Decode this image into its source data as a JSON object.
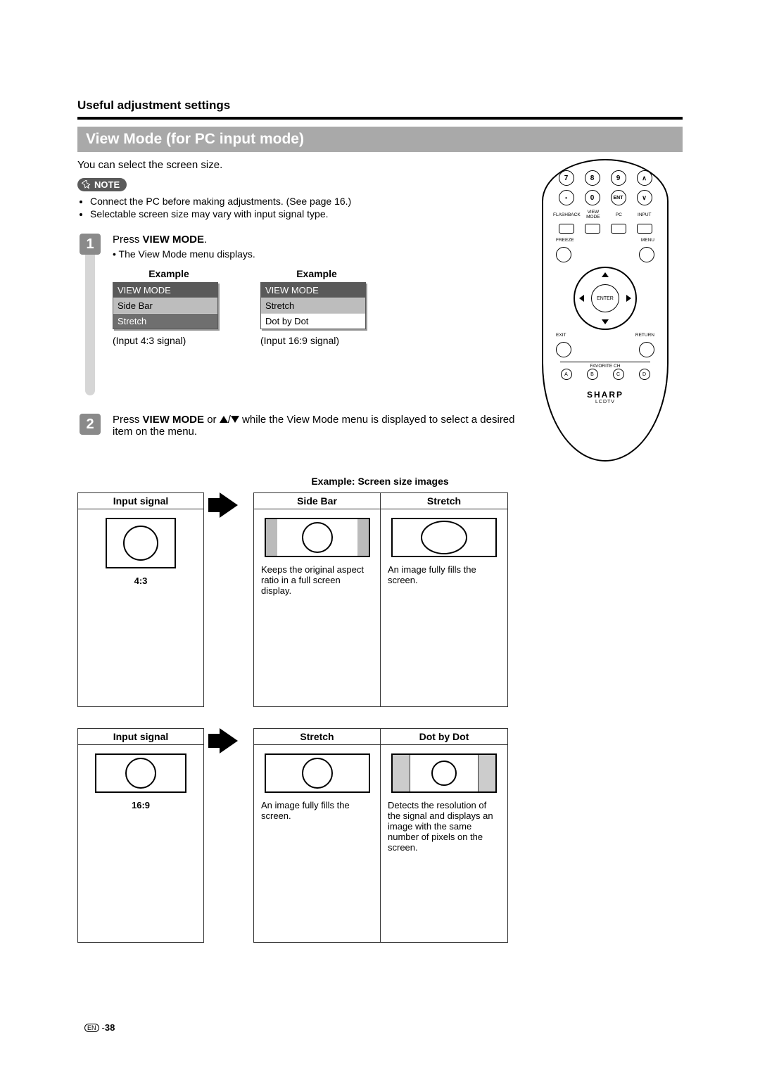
{
  "section_header": "Useful adjustment settings",
  "title": "View Mode (for PC input mode)",
  "intro": "You can select the screen size.",
  "note_label": "NOTE",
  "notes": [
    "Connect the PC before making adjustments. (See page 16.)",
    "Selectable screen size may vary with input signal type."
  ],
  "step1": {
    "num": "1",
    "text_pre": "Press ",
    "text_bold": "VIEW MODE",
    "text_post": ".",
    "sub": "• The View Mode menu displays.",
    "example_label": "Example",
    "menu1": {
      "title": "VIEW MODE",
      "items": [
        "Side Bar",
        "Stretch"
      ],
      "selected_idx": 0,
      "caption": "(Input 4:3 signal)"
    },
    "menu2": {
      "title": "VIEW MODE",
      "items": [
        "Stretch",
        "Dot by Dot"
      ],
      "selected_idx": 0,
      "caption": "(Input 16:9 signal)"
    }
  },
  "step2": {
    "num": "2",
    "text_pre": "Press ",
    "text_bold": "VIEW MODE",
    "text_mid": " or ",
    "text_post": " while the View Mode menu is displayed to select a desired item on the menu."
  },
  "image_table": {
    "title": "Example: Screen size images",
    "row1": {
      "input_head": "Input signal",
      "ratio": "4:3",
      "col1": {
        "head": "Side Bar",
        "desc": "Keeps the original aspect ratio in a full screen display."
      },
      "col2": {
        "head": "Stretch",
        "desc": "An image fully fills the screen."
      }
    },
    "row2": {
      "input_head": "Input signal",
      "ratio": "16:9",
      "col1": {
        "head": "Stretch",
        "desc": "An image fully fills the screen."
      },
      "col2": {
        "head": "Dot by Dot",
        "desc": "Detects the resolution of the signal and displays an image with the same number of pixels on the screen."
      }
    }
  },
  "remote": {
    "nums": [
      "7",
      "8",
      "9",
      "0"
    ],
    "ent": "ENT",
    "labels_row": [
      "FLASHBACK",
      "VIEW MODE",
      "PC",
      "INPUT"
    ],
    "freeze": "FREEZE",
    "menu": "MENU",
    "enter": "ENTER",
    "exit": "EXIT",
    "return": "RETURN",
    "fav": "FAVORITE CH",
    "favs": [
      "A",
      "B",
      "C",
      "D"
    ],
    "brand": "SHARP",
    "brand_sub": "LCDTV"
  },
  "footer": {
    "lang": "EN",
    "sep": " - ",
    "page": "38"
  }
}
